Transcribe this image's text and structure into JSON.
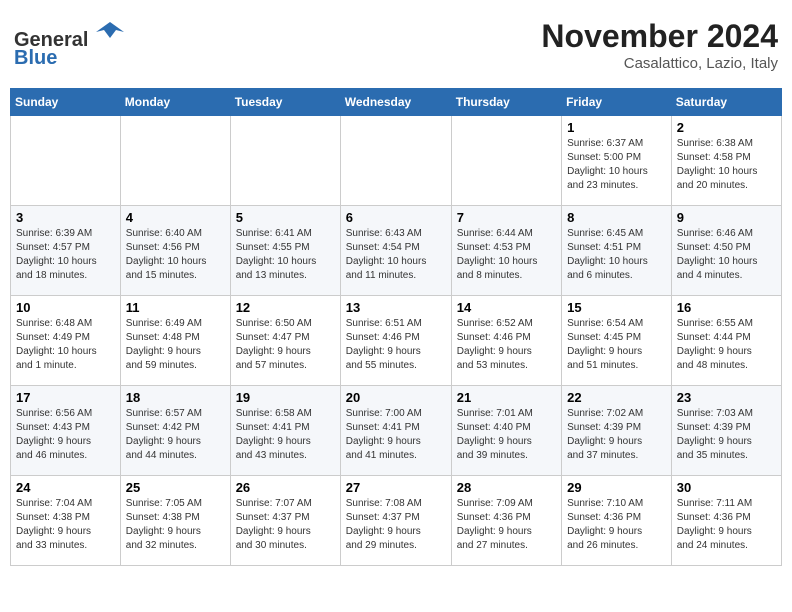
{
  "header": {
    "logo_line1": "General",
    "logo_line2": "Blue",
    "month": "November 2024",
    "location": "Casalattico, Lazio, Italy"
  },
  "weekdays": [
    "Sunday",
    "Monday",
    "Tuesday",
    "Wednesday",
    "Thursday",
    "Friday",
    "Saturday"
  ],
  "weeks": [
    [
      {
        "day": "",
        "info": ""
      },
      {
        "day": "",
        "info": ""
      },
      {
        "day": "",
        "info": ""
      },
      {
        "day": "",
        "info": ""
      },
      {
        "day": "",
        "info": ""
      },
      {
        "day": "1",
        "info": "Sunrise: 6:37 AM\nSunset: 5:00 PM\nDaylight: 10 hours\nand 23 minutes."
      },
      {
        "day": "2",
        "info": "Sunrise: 6:38 AM\nSunset: 4:58 PM\nDaylight: 10 hours\nand 20 minutes."
      }
    ],
    [
      {
        "day": "3",
        "info": "Sunrise: 6:39 AM\nSunset: 4:57 PM\nDaylight: 10 hours\nand 18 minutes."
      },
      {
        "day": "4",
        "info": "Sunrise: 6:40 AM\nSunset: 4:56 PM\nDaylight: 10 hours\nand 15 minutes."
      },
      {
        "day": "5",
        "info": "Sunrise: 6:41 AM\nSunset: 4:55 PM\nDaylight: 10 hours\nand 13 minutes."
      },
      {
        "day": "6",
        "info": "Sunrise: 6:43 AM\nSunset: 4:54 PM\nDaylight: 10 hours\nand 11 minutes."
      },
      {
        "day": "7",
        "info": "Sunrise: 6:44 AM\nSunset: 4:53 PM\nDaylight: 10 hours\nand 8 minutes."
      },
      {
        "day": "8",
        "info": "Sunrise: 6:45 AM\nSunset: 4:51 PM\nDaylight: 10 hours\nand 6 minutes."
      },
      {
        "day": "9",
        "info": "Sunrise: 6:46 AM\nSunset: 4:50 PM\nDaylight: 10 hours\nand 4 minutes."
      }
    ],
    [
      {
        "day": "10",
        "info": "Sunrise: 6:48 AM\nSunset: 4:49 PM\nDaylight: 10 hours\nand 1 minute."
      },
      {
        "day": "11",
        "info": "Sunrise: 6:49 AM\nSunset: 4:48 PM\nDaylight: 9 hours\nand 59 minutes."
      },
      {
        "day": "12",
        "info": "Sunrise: 6:50 AM\nSunset: 4:47 PM\nDaylight: 9 hours\nand 57 minutes."
      },
      {
        "day": "13",
        "info": "Sunrise: 6:51 AM\nSunset: 4:46 PM\nDaylight: 9 hours\nand 55 minutes."
      },
      {
        "day": "14",
        "info": "Sunrise: 6:52 AM\nSunset: 4:46 PM\nDaylight: 9 hours\nand 53 minutes."
      },
      {
        "day": "15",
        "info": "Sunrise: 6:54 AM\nSunset: 4:45 PM\nDaylight: 9 hours\nand 51 minutes."
      },
      {
        "day": "16",
        "info": "Sunrise: 6:55 AM\nSunset: 4:44 PM\nDaylight: 9 hours\nand 48 minutes."
      }
    ],
    [
      {
        "day": "17",
        "info": "Sunrise: 6:56 AM\nSunset: 4:43 PM\nDaylight: 9 hours\nand 46 minutes."
      },
      {
        "day": "18",
        "info": "Sunrise: 6:57 AM\nSunset: 4:42 PM\nDaylight: 9 hours\nand 44 minutes."
      },
      {
        "day": "19",
        "info": "Sunrise: 6:58 AM\nSunset: 4:41 PM\nDaylight: 9 hours\nand 43 minutes."
      },
      {
        "day": "20",
        "info": "Sunrise: 7:00 AM\nSunset: 4:41 PM\nDaylight: 9 hours\nand 41 minutes."
      },
      {
        "day": "21",
        "info": "Sunrise: 7:01 AM\nSunset: 4:40 PM\nDaylight: 9 hours\nand 39 minutes."
      },
      {
        "day": "22",
        "info": "Sunrise: 7:02 AM\nSunset: 4:39 PM\nDaylight: 9 hours\nand 37 minutes."
      },
      {
        "day": "23",
        "info": "Sunrise: 7:03 AM\nSunset: 4:39 PM\nDaylight: 9 hours\nand 35 minutes."
      }
    ],
    [
      {
        "day": "24",
        "info": "Sunrise: 7:04 AM\nSunset: 4:38 PM\nDaylight: 9 hours\nand 33 minutes."
      },
      {
        "day": "25",
        "info": "Sunrise: 7:05 AM\nSunset: 4:38 PM\nDaylight: 9 hours\nand 32 minutes."
      },
      {
        "day": "26",
        "info": "Sunrise: 7:07 AM\nSunset: 4:37 PM\nDaylight: 9 hours\nand 30 minutes."
      },
      {
        "day": "27",
        "info": "Sunrise: 7:08 AM\nSunset: 4:37 PM\nDaylight: 9 hours\nand 29 minutes."
      },
      {
        "day": "28",
        "info": "Sunrise: 7:09 AM\nSunset: 4:36 PM\nDaylight: 9 hours\nand 27 minutes."
      },
      {
        "day": "29",
        "info": "Sunrise: 7:10 AM\nSunset: 4:36 PM\nDaylight: 9 hours\nand 26 minutes."
      },
      {
        "day": "30",
        "info": "Sunrise: 7:11 AM\nSunset: 4:36 PM\nDaylight: 9 hours\nand 24 minutes."
      }
    ]
  ]
}
